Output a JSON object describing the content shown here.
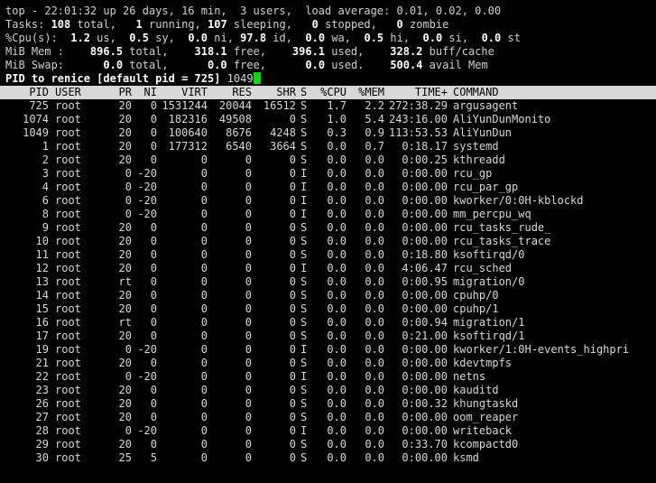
{
  "summary": {
    "line1": "top - 22:01:32 up 26 days, 16 min,  3 users,  load average: 0.01, 0.02, 0.00",
    "tasks_label": "Tasks: ",
    "tasks_total": "108",
    "tasks_total_label": " total,   ",
    "tasks_running": "1",
    "tasks_running_label": " running, ",
    "tasks_sleeping": "107",
    "tasks_sleeping_label": " sleeping,   ",
    "tasks_stopped": "0",
    "tasks_stopped_label": " stopped,   ",
    "tasks_zombie": "0",
    "tasks_zombie_label": " zombie",
    "cpu_label": "%Cpu(s):  ",
    "cpu_us": "1.2",
    "cpu_us_label": " us,  ",
    "cpu_sy": "0.5",
    "cpu_sy_label": " sy,  ",
    "cpu_ni": "0.0",
    "cpu_ni_label": " ni, ",
    "cpu_id": "97.8",
    "cpu_id_label": " id,  ",
    "cpu_wa": "0.0",
    "cpu_wa_label": " wa,  ",
    "cpu_hi": "0.5",
    "cpu_hi_label": " hi,  ",
    "cpu_si": "0.0",
    "cpu_si_label": " si,  ",
    "cpu_st": "0.0",
    "cpu_st_label": " st",
    "mem_label": "MiB Mem :    ",
    "mem_total": "896.5",
    "mem_total_label": " total,    ",
    "mem_free": "318.1",
    "mem_free_label": " free,    ",
    "mem_used": "396.1",
    "mem_used_label": " used,    ",
    "mem_buff": "328.2",
    "mem_buff_label": " buff/cache",
    "swap_label": "MiB Swap:      ",
    "swap_total": "0.0",
    "swap_total_label": " total,      ",
    "swap_free": "0.0",
    "swap_free_label": " free,      ",
    "swap_used": "0.0",
    "swap_used_label": " used.    ",
    "swap_avail": "500.4",
    "swap_avail_label": " avail Mem"
  },
  "prompt": {
    "text": "PID to renice [default pid = 725] ",
    "input_value": "1049"
  },
  "columns": [
    "PID",
    "USER",
    "PR",
    "NI",
    "VIRT",
    "RES",
    "SHR",
    "S",
    "%CPU",
    "%MEM",
    "TIME+",
    "COMMAND"
  ],
  "processes": [
    {
      "pid": "725",
      "user": "root",
      "pr": "20",
      "ni": "0",
      "virt": "1531244",
      "res": "20044",
      "shr": "16512",
      "s": "S",
      "cpu": "1.7",
      "mem": "2.2",
      "time": "272:38.29",
      "cmd": "argusagent"
    },
    {
      "pid": "1074",
      "user": "root",
      "pr": "20",
      "ni": "0",
      "virt": "182316",
      "res": "49508",
      "shr": "0",
      "s": "S",
      "cpu": "1.0",
      "mem": "5.4",
      "time": "243:16.00",
      "cmd": "AliYunDunMonito"
    },
    {
      "pid": "1049",
      "user": "root",
      "pr": "20",
      "ni": "0",
      "virt": "100640",
      "res": "8676",
      "shr": "4248",
      "s": "S",
      "cpu": "0.3",
      "mem": "0.9",
      "time": "113:53.53",
      "cmd": "AliYunDun"
    },
    {
      "pid": "1",
      "user": "root",
      "pr": "20",
      "ni": "0",
      "virt": "177312",
      "res": "6540",
      "shr": "3664",
      "s": "S",
      "cpu": "0.0",
      "mem": "0.7",
      "time": "0:18.17",
      "cmd": "systemd"
    },
    {
      "pid": "2",
      "user": "root",
      "pr": "20",
      "ni": "0",
      "virt": "0",
      "res": "0",
      "shr": "0",
      "s": "S",
      "cpu": "0.0",
      "mem": "0.0",
      "time": "0:00.25",
      "cmd": "kthreadd"
    },
    {
      "pid": "3",
      "user": "root",
      "pr": "0",
      "ni": "-20",
      "virt": "0",
      "res": "0",
      "shr": "0",
      "s": "I",
      "cpu": "0.0",
      "mem": "0.0",
      "time": "0:00.00",
      "cmd": "rcu_gp"
    },
    {
      "pid": "4",
      "user": "root",
      "pr": "0",
      "ni": "-20",
      "virt": "0",
      "res": "0",
      "shr": "0",
      "s": "I",
      "cpu": "0.0",
      "mem": "0.0",
      "time": "0:00.00",
      "cmd": "rcu_par_gp"
    },
    {
      "pid": "6",
      "user": "root",
      "pr": "0",
      "ni": "-20",
      "virt": "0",
      "res": "0",
      "shr": "0",
      "s": "I",
      "cpu": "0.0",
      "mem": "0.0",
      "time": "0:00.00",
      "cmd": "kworker/0:0H-kblockd"
    },
    {
      "pid": "8",
      "user": "root",
      "pr": "0",
      "ni": "-20",
      "virt": "0",
      "res": "0",
      "shr": "0",
      "s": "I",
      "cpu": "0.0",
      "mem": "0.0",
      "time": "0:00.00",
      "cmd": "mm_percpu_wq"
    },
    {
      "pid": "9",
      "user": "root",
      "pr": "20",
      "ni": "0",
      "virt": "0",
      "res": "0",
      "shr": "0",
      "s": "S",
      "cpu": "0.0",
      "mem": "0.0",
      "time": "0:00.00",
      "cmd": "rcu_tasks_rude_"
    },
    {
      "pid": "10",
      "user": "root",
      "pr": "20",
      "ni": "0",
      "virt": "0",
      "res": "0",
      "shr": "0",
      "s": "S",
      "cpu": "0.0",
      "mem": "0.0",
      "time": "0:00.00",
      "cmd": "rcu_tasks_trace"
    },
    {
      "pid": "11",
      "user": "root",
      "pr": "20",
      "ni": "0",
      "virt": "0",
      "res": "0",
      "shr": "0",
      "s": "S",
      "cpu": "0.0",
      "mem": "0.0",
      "time": "0:18.80",
      "cmd": "ksoftirqd/0"
    },
    {
      "pid": "12",
      "user": "root",
      "pr": "20",
      "ni": "0",
      "virt": "0",
      "res": "0",
      "shr": "0",
      "s": "I",
      "cpu": "0.0",
      "mem": "0.0",
      "time": "4:06.47",
      "cmd": "rcu_sched"
    },
    {
      "pid": "13",
      "user": "root",
      "pr": "rt",
      "ni": "0",
      "virt": "0",
      "res": "0",
      "shr": "0",
      "s": "S",
      "cpu": "0.0",
      "mem": "0.0",
      "time": "0:00.95",
      "cmd": "migration/0"
    },
    {
      "pid": "14",
      "user": "root",
      "pr": "20",
      "ni": "0",
      "virt": "0",
      "res": "0",
      "shr": "0",
      "s": "S",
      "cpu": "0.0",
      "mem": "0.0",
      "time": "0:00.00",
      "cmd": "cpuhp/0"
    },
    {
      "pid": "15",
      "user": "root",
      "pr": "20",
      "ni": "0",
      "virt": "0",
      "res": "0",
      "shr": "0",
      "s": "S",
      "cpu": "0.0",
      "mem": "0.0",
      "time": "0:00.00",
      "cmd": "cpuhp/1"
    },
    {
      "pid": "16",
      "user": "root",
      "pr": "rt",
      "ni": "0",
      "virt": "0",
      "res": "0",
      "shr": "0",
      "s": "S",
      "cpu": "0.0",
      "mem": "0.0",
      "time": "0:00.94",
      "cmd": "migration/1"
    },
    {
      "pid": "17",
      "user": "root",
      "pr": "20",
      "ni": "0",
      "virt": "0",
      "res": "0",
      "shr": "0",
      "s": "S",
      "cpu": "0.0",
      "mem": "0.0",
      "time": "0:21.00",
      "cmd": "ksoftirqd/1"
    },
    {
      "pid": "19",
      "user": "root",
      "pr": "0",
      "ni": "-20",
      "virt": "0",
      "res": "0",
      "shr": "0",
      "s": "I",
      "cpu": "0.0",
      "mem": "0.0",
      "time": "0:00.00",
      "cmd": "kworker/1:0H-events_highpri"
    },
    {
      "pid": "21",
      "user": "root",
      "pr": "20",
      "ni": "0",
      "virt": "0",
      "res": "0",
      "shr": "0",
      "s": "S",
      "cpu": "0.0",
      "mem": "0.0",
      "time": "0:00.00",
      "cmd": "kdevtmpfs"
    },
    {
      "pid": "22",
      "user": "root",
      "pr": "0",
      "ni": "-20",
      "virt": "0",
      "res": "0",
      "shr": "0",
      "s": "I",
      "cpu": "0.0",
      "mem": "0.0",
      "time": "0:00.00",
      "cmd": "netns"
    },
    {
      "pid": "23",
      "user": "root",
      "pr": "20",
      "ni": "0",
      "virt": "0",
      "res": "0",
      "shr": "0",
      "s": "S",
      "cpu": "0.0",
      "mem": "0.0",
      "time": "0:00.00",
      "cmd": "kauditd"
    },
    {
      "pid": "26",
      "user": "root",
      "pr": "20",
      "ni": "0",
      "virt": "0",
      "res": "0",
      "shr": "0",
      "s": "S",
      "cpu": "0.0",
      "mem": "0.0",
      "time": "0:00.32",
      "cmd": "khungtaskd"
    },
    {
      "pid": "27",
      "user": "root",
      "pr": "20",
      "ni": "0",
      "virt": "0",
      "res": "0",
      "shr": "0",
      "s": "S",
      "cpu": "0.0",
      "mem": "0.0",
      "time": "0:00.00",
      "cmd": "oom_reaper"
    },
    {
      "pid": "28",
      "user": "root",
      "pr": "0",
      "ni": "-20",
      "virt": "0",
      "res": "0",
      "shr": "0",
      "s": "I",
      "cpu": "0.0",
      "mem": "0.0",
      "time": "0:00.00",
      "cmd": "writeback"
    },
    {
      "pid": "29",
      "user": "root",
      "pr": "20",
      "ni": "0",
      "virt": "0",
      "res": "0",
      "shr": "0",
      "s": "S",
      "cpu": "0.0",
      "mem": "0.0",
      "time": "0:33.70",
      "cmd": "kcompactd0"
    },
    {
      "pid": "30",
      "user": "root",
      "pr": "25",
      "ni": "5",
      "virt": "0",
      "res": "0",
      "shr": "0",
      "s": "S",
      "cpu": "0.0",
      "mem": "0.0",
      "time": "0:00.00",
      "cmd": "ksmd"
    }
  ],
  "colors": {
    "background": "#000000",
    "text": "#d0d0d0",
    "bold_text": "#ffffff",
    "header_bg": "#d8d8d8",
    "cursor": "#00e000"
  }
}
